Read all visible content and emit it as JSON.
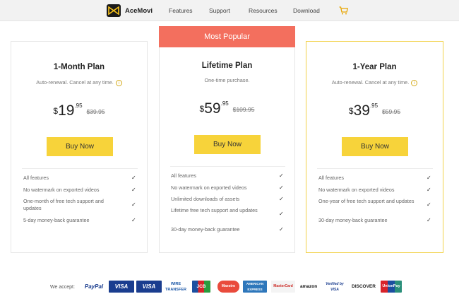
{
  "nav": {
    "brand": "AceMovi",
    "items": [
      "Features",
      "Support",
      "Resources",
      "Download"
    ]
  },
  "banner": "Most Popular",
  "plans": [
    {
      "title": "1-Month Plan",
      "subtitle": "Auto-renewal. Cancel at any time.",
      "currency": "$",
      "price": "19",
      "cents": ".95",
      "old_price": "$39.95",
      "buy": "Buy Now",
      "features": [
        "All features",
        "No watermark on exported videos",
        "One-month of free tech support and updates",
        "5-day money-back guarantee"
      ]
    },
    {
      "title": "Lifetime Plan",
      "subtitle": "One-time purchase.",
      "currency": "$",
      "price": "59",
      "cents": ".95",
      "old_price": "$109.95",
      "buy": "Buy Now",
      "features": [
        "All features",
        "No watermark on exported videos",
        "Unlimited downloads of assets",
        "Lifetime free tech support and updates",
        "30-day money-back guarantee"
      ]
    },
    {
      "title": "1-Year Plan",
      "subtitle": "Auto-renewal. Cancel at any time.",
      "currency": "$",
      "price": "39",
      "cents": ".95",
      "old_price": "$59.95",
      "buy": "Buy Now",
      "features": [
        "All features",
        "No watermark on exported videos",
        "One-year of free tech support and updates",
        "30-day money-back guarantee"
      ]
    }
  ],
  "payment": {
    "label": "We accept:",
    "methods": [
      "PayPal",
      "VISA",
      "VISA",
      "WIRE TRANSFER",
      "JCB",
      "Maestro",
      "AMERICAN EXPRESS",
      "MasterCard",
      "amazon",
      "Verified by VISA",
      "DISCOVER",
      "UnionPay"
    ]
  },
  "colors": {
    "accent": "#f7d33a",
    "banner": "#f36f5e",
    "highlight_border": "#f2d24a"
  }
}
